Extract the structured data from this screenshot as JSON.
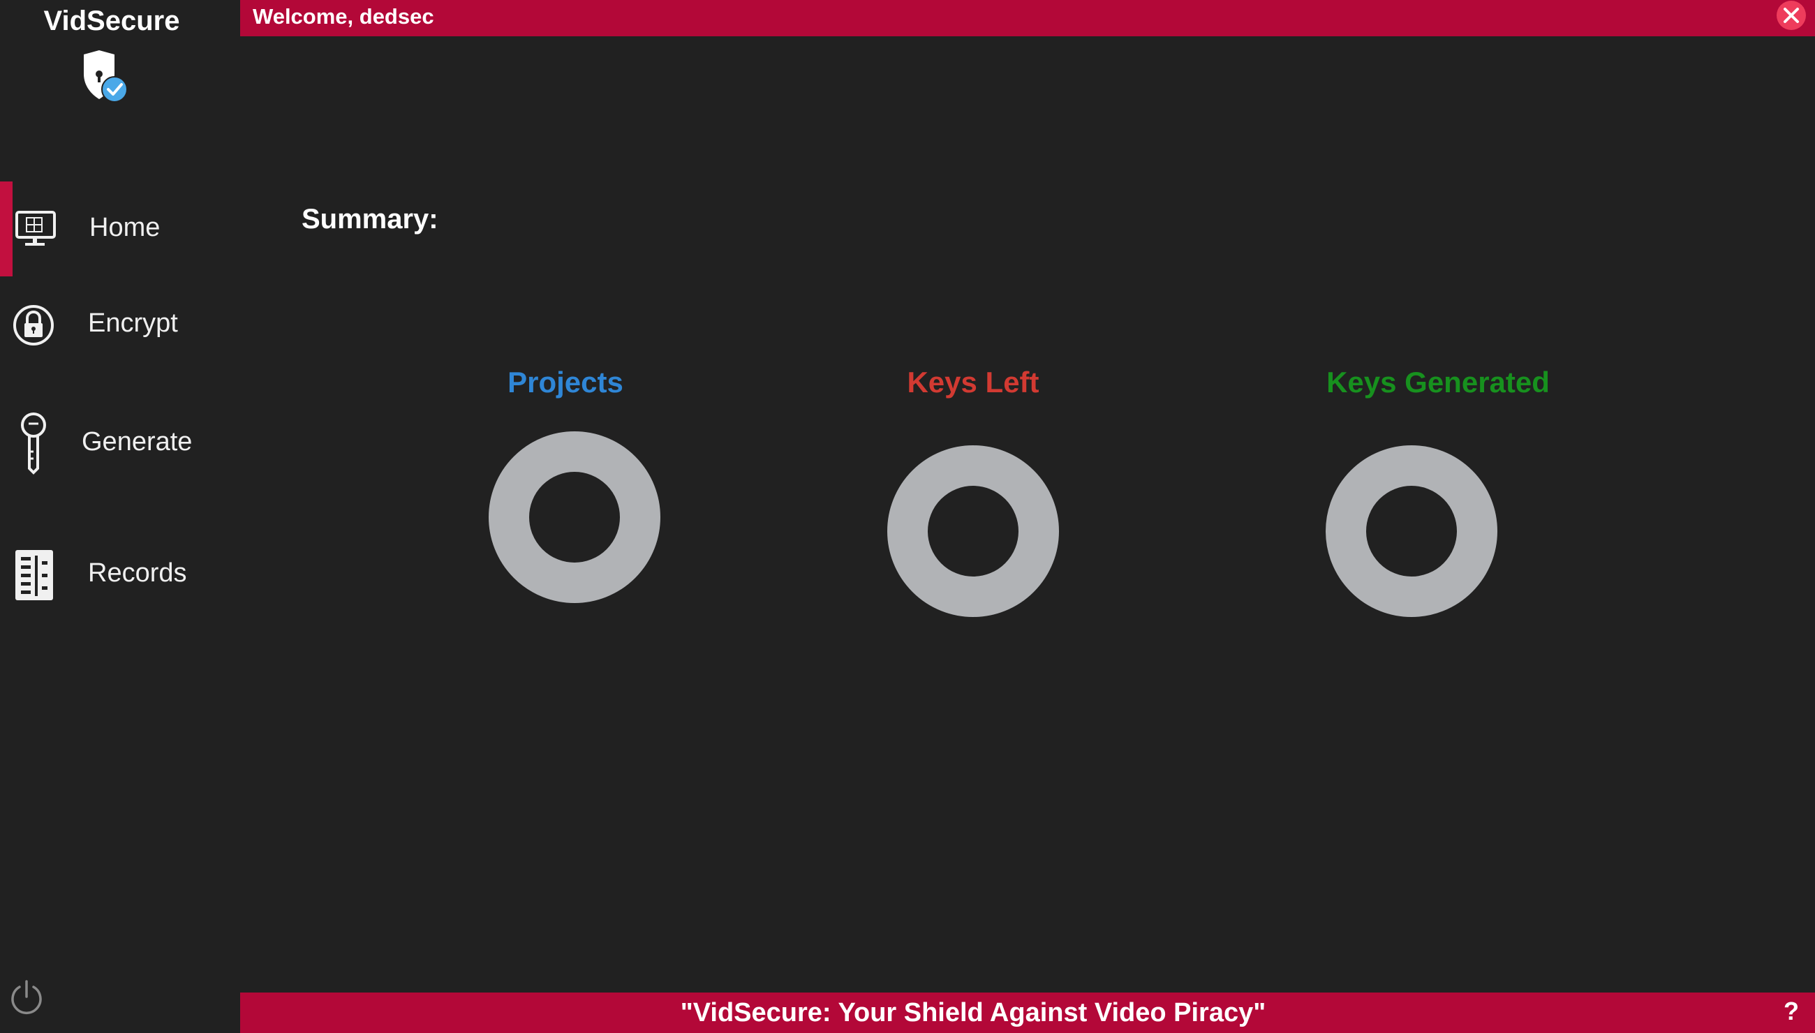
{
  "app": {
    "brand": "VidSecure"
  },
  "header": {
    "welcome": "Welcome, dedsec"
  },
  "nav": {
    "items": [
      {
        "label": "Home",
        "icon": "monitor-icon",
        "active": true
      },
      {
        "label": "Encrypt",
        "icon": "lock-icon",
        "active": false
      },
      {
        "label": "Generate",
        "icon": "key-icon",
        "active": false
      },
      {
        "label": "Records",
        "icon": "records-icon",
        "active": false
      }
    ]
  },
  "main": {
    "summary_label": "Summary:",
    "stats": [
      {
        "title": "Projects",
        "color": "#2f86d6"
      },
      {
        "title": "Keys Left",
        "color": "#d23a32"
      },
      {
        "title": "Keys Generated",
        "color": "#17911e"
      }
    ]
  },
  "footer": {
    "tagline": "\"VidSecure: Your Shield Against Video Piracy\"",
    "help": "?"
  },
  "colors": {
    "accent": "#b30838",
    "background": "#212121",
    "ring": "#b1b3b6"
  }
}
